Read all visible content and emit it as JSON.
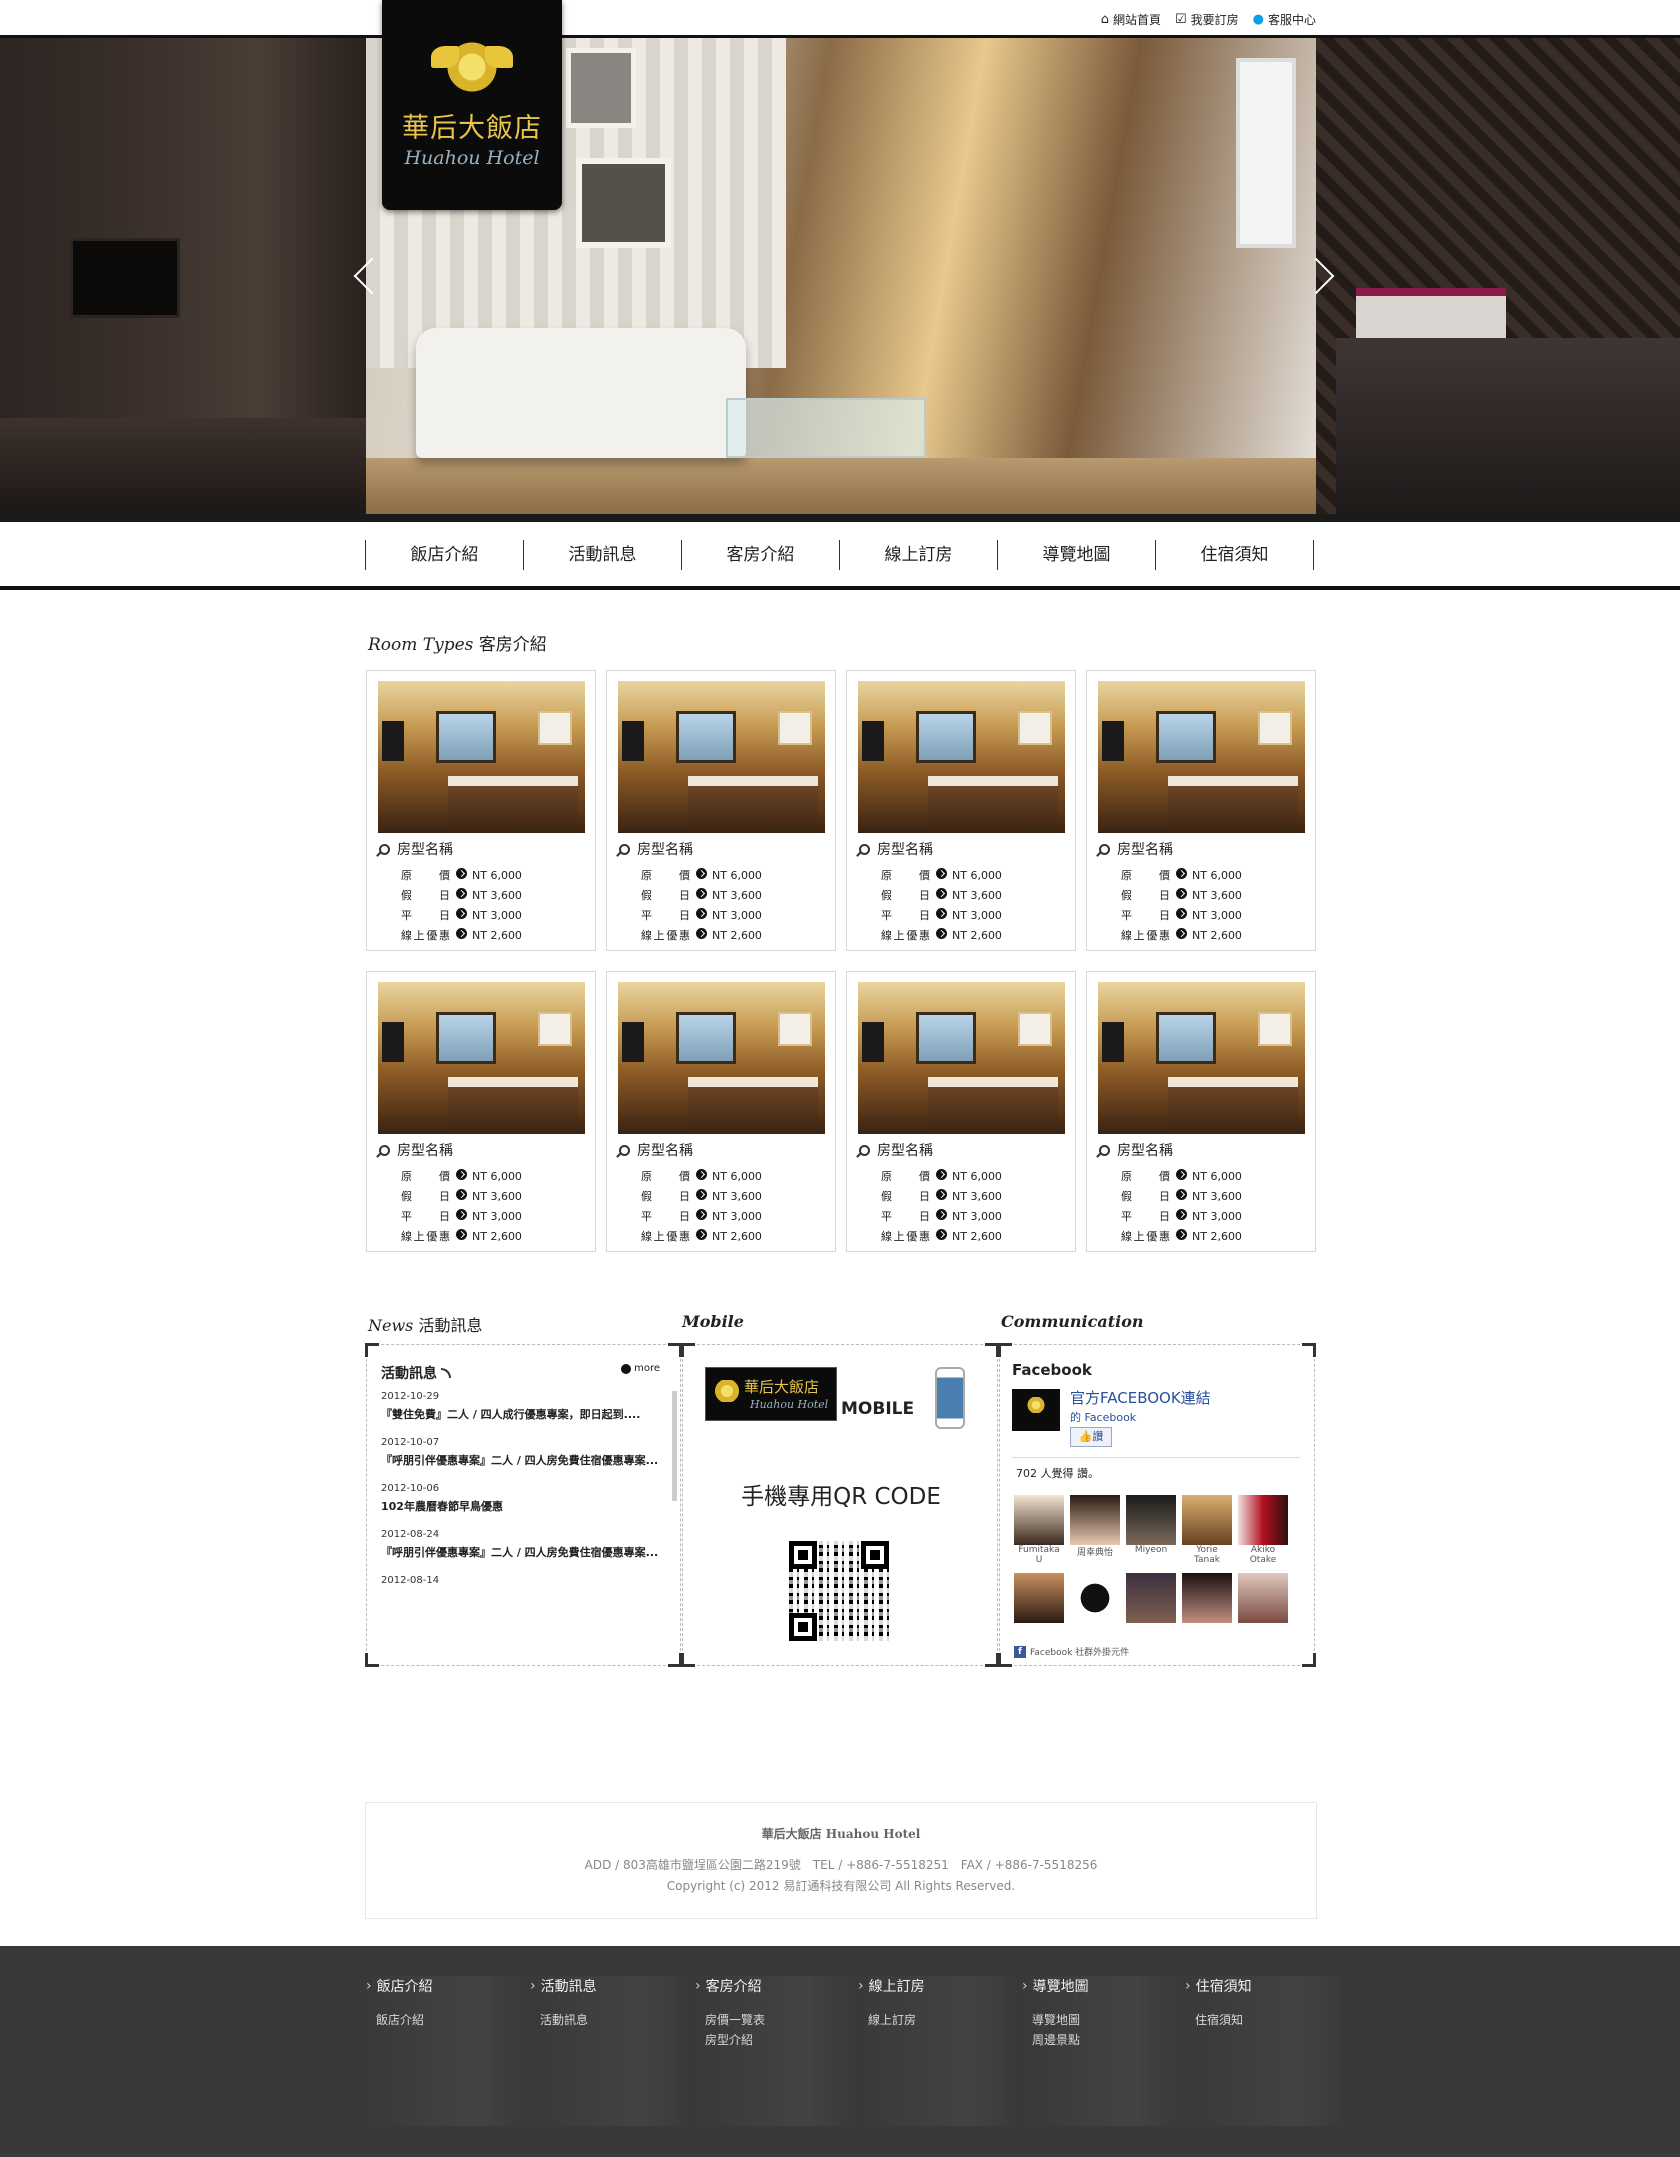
{
  "top_links": [
    {
      "icon": "home-icon",
      "label": "網站首頁"
    },
    {
      "icon": "checkbox-icon",
      "label": "我要訂房"
    },
    {
      "icon": "skype-icon",
      "label": "客服中心"
    }
  ],
  "logo": {
    "cn": "華后大飯店",
    "en": "Huahou Hotel"
  },
  "nav": [
    "飯店介紹",
    "活動訊息",
    "客房介紹",
    "線上訂房",
    "導覽地圖",
    "住宿須知"
  ],
  "rooms_section": {
    "title_en": "Room Types",
    "title_cn": "客房介紹"
  },
  "rooms": [
    {
      "name": "房型名稱",
      "prices": [
        {
          "label": "原價",
          "value": "NT 6,000"
        },
        {
          "label": "假日",
          "value": "NT 3,600"
        },
        {
          "label": "平日",
          "value": "NT 3,000"
        },
        {
          "label": "線上優惠",
          "value": "NT 2,600"
        }
      ]
    },
    {
      "name": "房型名稱",
      "prices": [
        {
          "label": "原價",
          "value": "NT 6,000"
        },
        {
          "label": "假日",
          "value": "NT 3,600"
        },
        {
          "label": "平日",
          "value": "NT 3,000"
        },
        {
          "label": "線上優惠",
          "value": "NT 2,600"
        }
      ]
    },
    {
      "name": "房型名稱",
      "prices": [
        {
          "label": "原價",
          "value": "NT 6,000"
        },
        {
          "label": "假日",
          "value": "NT 3,600"
        },
        {
          "label": "平日",
          "value": "NT 3,000"
        },
        {
          "label": "線上優惠",
          "value": "NT 2,600"
        }
      ]
    },
    {
      "name": "房型名稱",
      "prices": [
        {
          "label": "原價",
          "value": "NT 6,000"
        },
        {
          "label": "假日",
          "value": "NT 3,600"
        },
        {
          "label": "平日",
          "value": "NT 3,000"
        },
        {
          "label": "線上優惠",
          "value": "NT 2,600"
        }
      ]
    },
    {
      "name": "房型名稱",
      "prices": [
        {
          "label": "原價",
          "value": "NT 6,000"
        },
        {
          "label": "假日",
          "value": "NT 3,600"
        },
        {
          "label": "平日",
          "value": "NT 3,000"
        },
        {
          "label": "線上優惠",
          "value": "NT 2,600"
        }
      ]
    },
    {
      "name": "房型名稱",
      "prices": [
        {
          "label": "原價",
          "value": "NT 6,000"
        },
        {
          "label": "假日",
          "value": "NT 3,600"
        },
        {
          "label": "平日",
          "value": "NT 3,000"
        },
        {
          "label": "線上優惠",
          "value": "NT 2,600"
        }
      ]
    },
    {
      "name": "房型名稱",
      "prices": [
        {
          "label": "原價",
          "value": "NT 6,000"
        },
        {
          "label": "假日",
          "value": "NT 3,600"
        },
        {
          "label": "平日",
          "value": "NT 3,000"
        },
        {
          "label": "線上優惠",
          "value": "NT 2,600"
        }
      ]
    },
    {
      "name": "房型名稱",
      "prices": [
        {
          "label": "原價",
          "value": "NT 6,000"
        },
        {
          "label": "假日",
          "value": "NT 3,600"
        },
        {
          "label": "平日",
          "value": "NT 3,000"
        },
        {
          "label": "線上優惠",
          "value": "NT 2,600"
        }
      ]
    }
  ],
  "news_section": {
    "title_en": "News",
    "title_cn": "活動訊息",
    "box_title": "活動訊息",
    "more": "more"
  },
  "news": [
    {
      "date": "2012-10-29",
      "title": "『雙住免費』二人 / 四人成行優惠專案，即日起到...."
    },
    {
      "date": "2012-10-07",
      "title": "『呼朋引伴優惠專案』二人 / 四人房免費住宿優惠專案..."
    },
    {
      "date": "2012-10-06",
      "title": "102年農曆春節早鳥優惠"
    },
    {
      "date": "2012-08-24",
      "title": "『呼朋引伴優惠專案』二人 / 四人房免費住宿優惠專案..."
    },
    {
      "date": "2012-08-14",
      "title": ""
    }
  ],
  "mobile_section": {
    "title": "Mobile",
    "mobile_label": "MOBILE",
    "qr_title": "手機專用QR CODE"
  },
  "comm_section": {
    "title": "Communication",
    "fb_title": "Facebook",
    "page_name": "官方FACEBOOK連結",
    "page_sub": "的 Facebook",
    "like": "讚",
    "count_text": "702 人覺得 讚。",
    "fans_row1": [
      "Fumitaka U",
      "周幸典怡",
      "Miyeon",
      "Yorie Tanak",
      "Akiko Otake"
    ],
    "fans_row2": [
      "",
      "",
      "",
      "",
      ""
    ],
    "plugin": "Facebook 社群外掛元件"
  },
  "address": {
    "name": "華后大飯店 Huahou Hotel",
    "line": "ADD / 803高雄市鹽埕區公園二路219號　TEL / +886-7-5518251　FAX / +886-7-5518256",
    "copyright": "Copyright (c) 2012 易訂通科技有限公司 All Rights Reserved."
  },
  "footer": [
    {
      "head": "飯店介紹",
      "items": [
        "飯店介紹"
      ]
    },
    {
      "head": "活動訊息",
      "items": [
        "活動訊息"
      ]
    },
    {
      "head": "客房介紹",
      "items": [
        "房價一覽表",
        "房型介紹"
      ]
    },
    {
      "head": "線上訂房",
      "items": [
        "線上訂房"
      ]
    },
    {
      "head": "導覽地圖",
      "items": [
        "導覽地圖",
        "周邊景點"
      ]
    },
    {
      "head": "住宿須知",
      "items": [
        "住宿須知"
      ]
    }
  ],
  "colors": {
    "accent_gold": "#e6c44a",
    "footer_bg": "#3a3839",
    "link_blue": "#2a4f9a"
  }
}
